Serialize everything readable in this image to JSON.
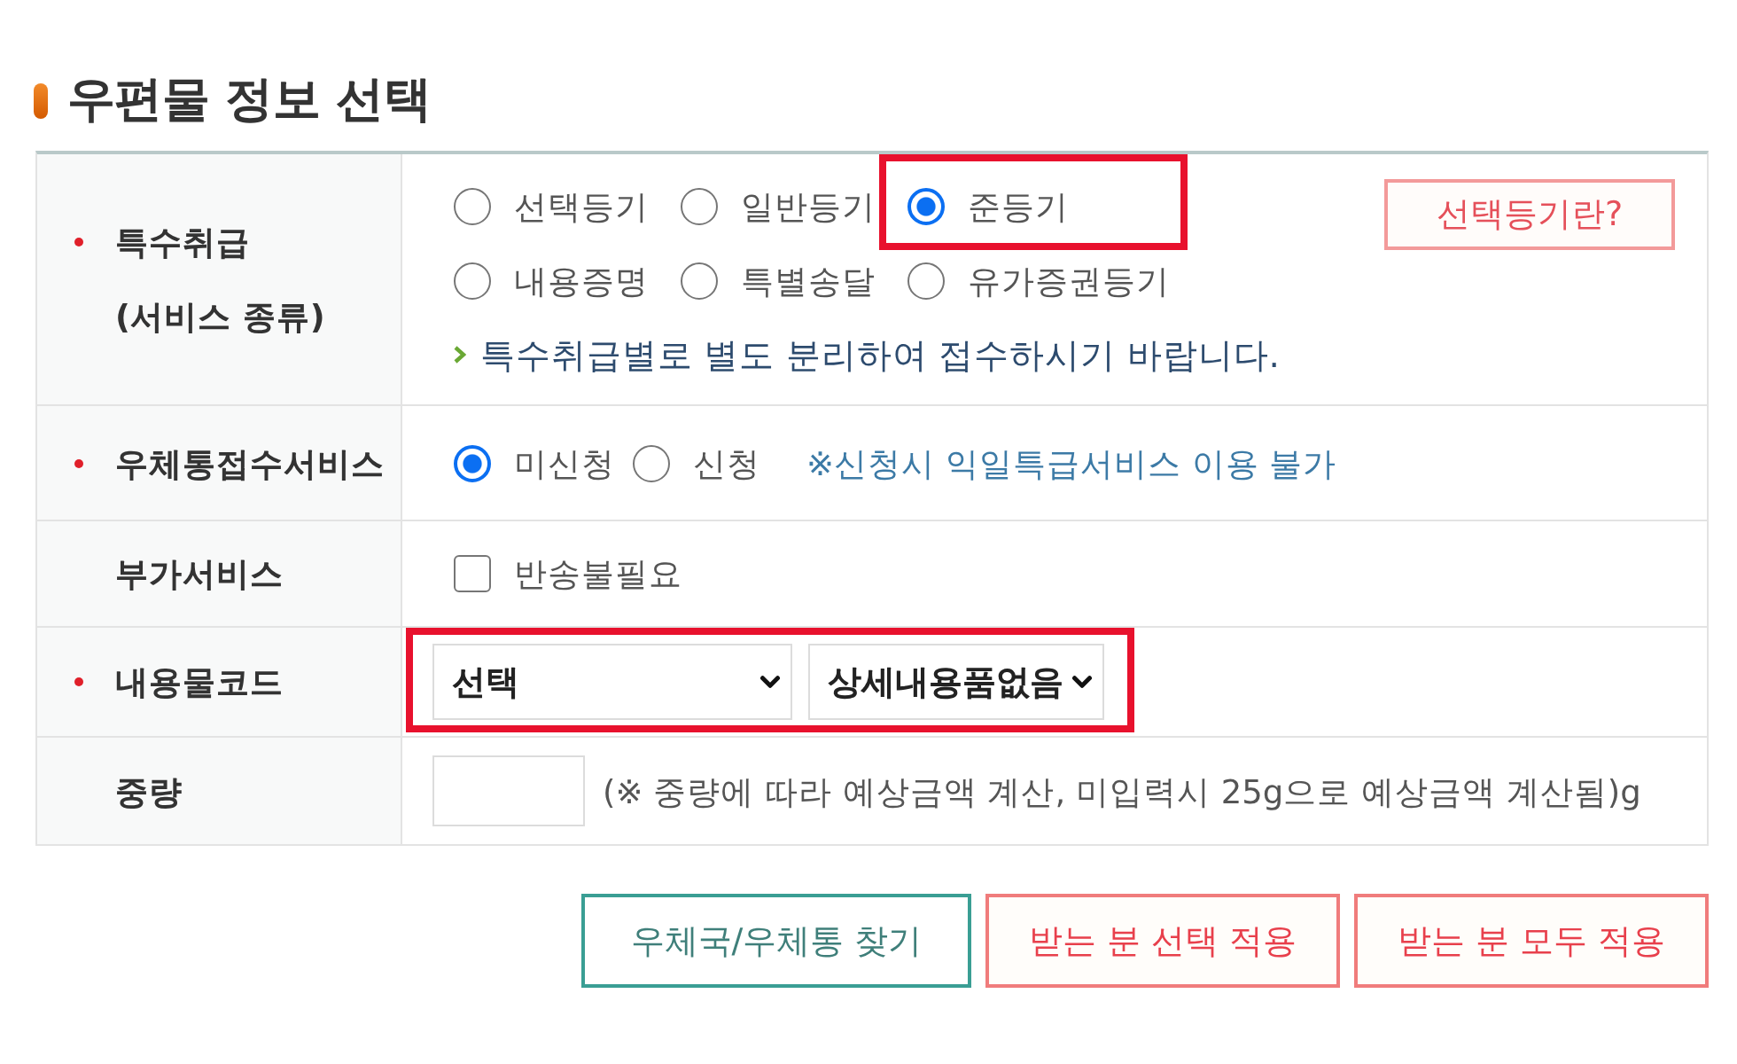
{
  "title": "우편물 정보 선택",
  "form": {
    "rows": [
      {
        "kind": "radio-grid",
        "required": true,
        "label": "특수취급",
        "sublabel": "(서비스 종류)",
        "options": [
          {
            "label": "선택등기",
            "selected": false,
            "highlighted": false
          },
          {
            "label": "일반등기",
            "selected": false,
            "highlighted": false
          },
          {
            "label": "준등기",
            "selected": true,
            "highlighted": true
          },
          {
            "label": "내용증명",
            "selected": false,
            "highlighted": false
          },
          {
            "label": "특별송달",
            "selected": false,
            "highlighted": false
          },
          {
            "label": "유가증권등기",
            "selected": false,
            "highlighted": false
          }
        ],
        "side_button": "선택등기란?",
        "note": "특수취급별로 별도 분리하여 접수하시기 바랍니다."
      },
      {
        "kind": "radio-inline",
        "required": true,
        "label": "우체통접수서비스",
        "options": [
          {
            "label": "미신청",
            "selected": true
          },
          {
            "label": "신청",
            "selected": false
          }
        ],
        "note": "※신청시 익일특급서비스 이용 불가"
      },
      {
        "kind": "checkbox",
        "required": false,
        "label": "부가서비스",
        "options": [
          {
            "label": "반송불필요",
            "checked": false
          }
        ]
      },
      {
        "kind": "selects",
        "required": true,
        "label": "내용물코드",
        "highlighted": true,
        "selects": [
          {
            "value": "선택"
          },
          {
            "value": "상세내용품없음"
          }
        ]
      },
      {
        "kind": "input",
        "required": false,
        "label": "중량",
        "note": "(※ 중량에 따라 예상금액 계산, 미입력시 25g으로 예상금액 계산됨)g"
      }
    ]
  },
  "buttons": [
    {
      "label": "우체국/우체통 찾기",
      "kind": "locate"
    },
    {
      "label": "받는 분 선택 적용",
      "kind": "apply"
    },
    {
      "label": "받는 분 모두 적용",
      "kind": "apply"
    }
  ]
}
